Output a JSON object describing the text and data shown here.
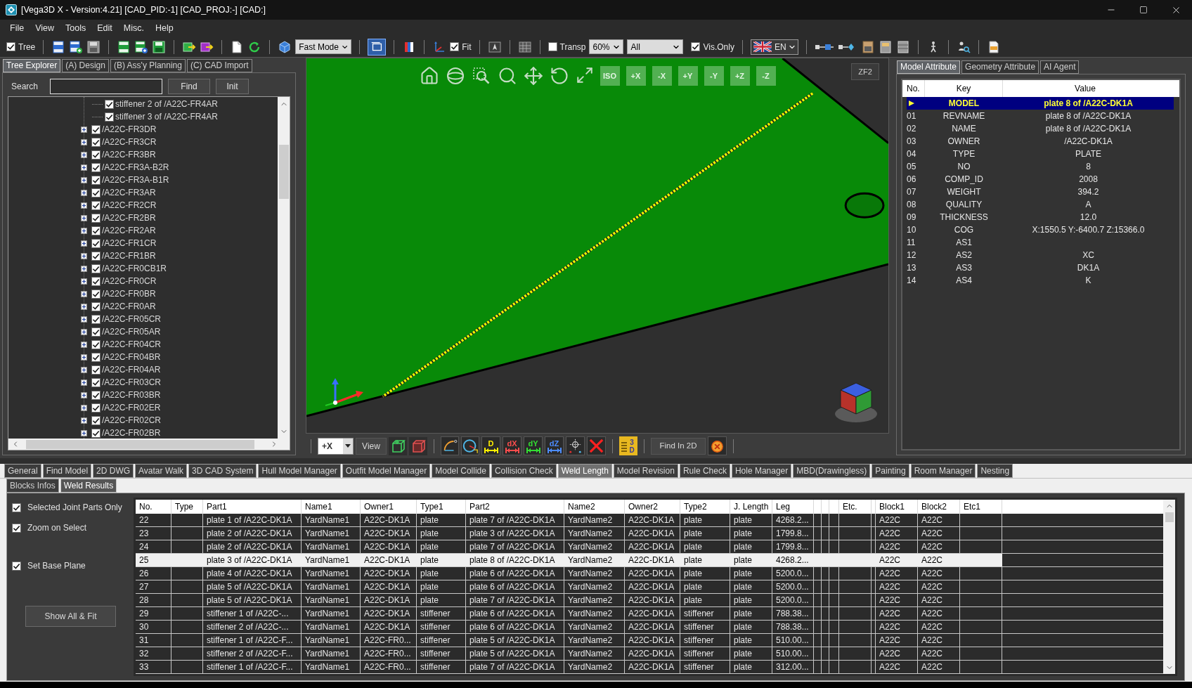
{
  "window": {
    "title": "[Vega3D X - Version:4.21] [CAD_PID:-1] [CAD_PROJ:-] [CAD:]"
  },
  "menu": [
    "File",
    "View",
    "Tools",
    "Edit",
    "Misc.",
    "Help"
  ],
  "toolbar": {
    "tree": {
      "label": "Tree",
      "checked": true
    },
    "render_mode": "Fast Mode",
    "fit": {
      "label": "Fit",
      "checked": true
    },
    "transparency": {
      "label": "Transp",
      "checked": false
    },
    "opacity": "60%",
    "filter": "All",
    "visible_only": {
      "label": "Vis.Only",
      "checked": true
    },
    "language": "EN"
  },
  "left_panel": {
    "tabs": [
      {
        "label": "Tree Explorer",
        "selected": true
      },
      {
        "label": "(A) Design",
        "selected": false
      },
      {
        "label": "(B) Ass'y Planning",
        "selected": false
      },
      {
        "label": "(C) CAD Import",
        "selected": false
      }
    ],
    "search_label": "Search",
    "buttons": [
      "Find",
      "Init"
    ],
    "tree": [
      {
        "children": [
          {
            "label": "stiffener 2 of /A22C-FR4AR",
            "checked": true
          },
          {
            "label": "stiffener 3 of /A22C-FR4AR",
            "checked": true
          }
        ]
      },
      {
        "label": "/A22C-FR3DR",
        "checked": true,
        "expanded": false
      },
      {
        "label": "/A22C-FR3CR",
        "checked": true,
        "expanded": false
      },
      {
        "label": "/A22C-FR3BR",
        "checked": true,
        "expanded": false
      },
      {
        "label": "/A22C-FR3A-B2R",
        "checked": true,
        "expanded": false
      },
      {
        "label": "/A22C-FR3A-B1R",
        "checked": true,
        "expanded": false
      },
      {
        "label": "/A22C-FR3AR",
        "checked": true,
        "expanded": false
      },
      {
        "label": "/A22C-FR2CR",
        "checked": true,
        "expanded": false
      },
      {
        "label": "/A22C-FR2BR",
        "checked": true,
        "expanded": false
      },
      {
        "label": "/A22C-FR2AR",
        "checked": true,
        "expanded": false
      },
      {
        "label": "/A22C-FR1CR",
        "checked": true,
        "expanded": false
      },
      {
        "label": "/A22C-FR1BR",
        "checked": true,
        "expanded": false
      },
      {
        "label": "/A22C-FR0CB1R",
        "checked": true,
        "expanded": false
      },
      {
        "label": "/A22C-FR0CR",
        "checked": true,
        "expanded": false
      },
      {
        "label": "/A22C-FR0BR",
        "checked": true,
        "expanded": false
      },
      {
        "label": "/A22C-FR0AR",
        "checked": true,
        "expanded": false
      },
      {
        "label": "/A22C-FR05CR",
        "checked": true,
        "expanded": false
      },
      {
        "label": "/A22C-FR05AR",
        "checked": true,
        "expanded": false
      },
      {
        "label": "/A22C-FR04CR",
        "checked": true,
        "expanded": false
      },
      {
        "label": "/A22C-FR04BR",
        "checked": true,
        "expanded": false
      },
      {
        "label": "/A22C-FR04AR",
        "checked": true,
        "expanded": false
      },
      {
        "label": "/A22C-FR03CR",
        "checked": true,
        "expanded": false
      },
      {
        "label": "/A22C-FR03BR",
        "checked": true,
        "expanded": false
      },
      {
        "label": "/A22C-FR02ER",
        "checked": true,
        "expanded": false
      },
      {
        "label": "/A22C-FR02CR",
        "checked": true,
        "expanded": false
      },
      {
        "label": "/A22C-FR02BR",
        "checked": true,
        "expanded": false
      }
    ]
  },
  "viewport": {
    "view_buttons": [
      "ISO",
      "+X",
      "-X",
      "+Y",
      "-Y",
      "+Z",
      "-Z"
    ],
    "zoom_badge": "ZF2",
    "view_direction": "+X",
    "view_button": "View",
    "dimension_tools": [
      {
        "label": "D",
        "color": "#ffee00"
      },
      {
        "label": "dX",
        "color": "#ff4d4d"
      },
      {
        "label": "dY",
        "color": "#33dd33"
      },
      {
        "label": "dZ",
        "color": "#4d8cff"
      }
    ],
    "report_button": "3D",
    "find_button": "Find In 2D"
  },
  "attributes": {
    "tabs": [
      {
        "label": "Model Attribute",
        "selected": true
      },
      {
        "label": "Geometry Attribute",
        "selected": false
      },
      {
        "label": "AI Agent",
        "selected": false
      }
    ],
    "columns": [
      "No.",
      "Key",
      "Value"
    ],
    "rows": [
      {
        "key": "MODEL",
        "value": "plate 8 of /A22C-DK1A",
        "selected": true
      },
      {
        "no": "01",
        "key": "REVNAME",
        "value": "plate 8 of /A22C-DK1A",
        "selected": false
      },
      {
        "no": "02",
        "key": "NAME",
        "value": "plate 8 of /A22C-DK1A",
        "selected": false
      },
      {
        "no": "03",
        "key": "OWNER",
        "value": "/A22C-DK1A",
        "selected": false
      },
      {
        "no": "04",
        "key": "TYPE",
        "value": "PLATE",
        "selected": false
      },
      {
        "no": "05",
        "key": "NO",
        "value": "8",
        "selected": false
      },
      {
        "no": "06",
        "key": "COMP_ID",
        "value": "2008",
        "selected": false
      },
      {
        "no": "07",
        "key": "WEIGHT",
        "value": "394.2",
        "selected": false
      },
      {
        "no": "08",
        "key": "QUALITY",
        "value": "A",
        "selected": false
      },
      {
        "no": "09",
        "key": "THICKNESS",
        "value": "12.0",
        "selected": false
      },
      {
        "no": "10",
        "key": "COG",
        "value": "X:1550.5 Y:-6400.7 Z:15366.0",
        "selected": false
      },
      {
        "no": "11",
        "key": "AS1",
        "selected": false
      },
      {
        "no": "12",
        "key": "AS2",
        "value": "XC",
        "selected": false
      },
      {
        "no": "13",
        "key": "AS3",
        "value": "DK1A",
        "selected": false
      },
      {
        "no": "14",
        "key": "AS4",
        "value": "K",
        "selected": false
      }
    ]
  },
  "bottom": {
    "tabs": [
      {
        "label": "General",
        "selected": false
      },
      {
        "label": "Find Model",
        "selected": false
      },
      {
        "label": "2D DWG",
        "selected": false
      },
      {
        "label": "Avatar Walk",
        "selected": false
      },
      {
        "label": "3D CAD System",
        "selected": false
      },
      {
        "label": "Hull Model Manager",
        "selected": false
      },
      {
        "label": "Outfit Model Manager",
        "selected": false
      },
      {
        "label": "Model Collide",
        "selected": false
      },
      {
        "label": "Collision Check",
        "selected": false
      },
      {
        "label": "Weld Length",
        "selected": true
      },
      {
        "label": "Model Revision",
        "selected": false
      },
      {
        "label": "Rule Check",
        "selected": false
      },
      {
        "label": "Hole Manager",
        "selected": false
      },
      {
        "label": "MBD(Drawingless)",
        "selected": false
      },
      {
        "label": "Painting",
        "selected": false
      },
      {
        "label": "Room Manager",
        "selected": false
      },
      {
        "label": "Nesting",
        "selected": false
      }
    ],
    "subtabs": [
      {
        "label": "Blocks Infos",
        "selected": false
      },
      {
        "label": "Weld Results",
        "selected": true
      }
    ],
    "options": [
      {
        "label": "Selected Joint Parts Only",
        "checked": true
      },
      {
        "label": "Zoom on Select",
        "checked": true
      },
      {
        "label": "Set Base Plane",
        "checked": true
      }
    ],
    "show_all_button": "Show All & Fit",
    "table": {
      "columns": [
        "No.",
        "Type",
        "Part1",
        "Name1",
        "Owner1",
        "Type1",
        "Part2",
        "Name2",
        "Owner2",
        "Type2",
        "J. Length",
        "Leg",
        "Etc.",
        "Block1",
        "Block2",
        "Etc1"
      ],
      "rows": [
        {
          "no": "22",
          "part1": "plate 1 of /A22C-DK1A",
          "name1": "YardName1",
          "owner1": "A22C-DK1A",
          "type1": "plate",
          "part2": "plate 7 of /A22C-DK1A",
          "name2": "YardName2",
          "owner2": "A22C-DK1A",
          "type2": "plate",
          "j_length": "plate",
          "leg": "4268.2...",
          "block1": "A22C",
          "block2": "A22C",
          "selected": false
        },
        {
          "no": "23",
          "part1": "plate 2 of /A22C-DK1A",
          "name1": "YardName1",
          "owner1": "A22C-DK1A",
          "type1": "plate",
          "part2": "plate 3 of /A22C-DK1A",
          "name2": "YardName2",
          "owner2": "A22C-DK1A",
          "type2": "plate",
          "j_length": "plate",
          "leg": "1799.8...",
          "block1": "A22C",
          "block2": "A22C",
          "selected": false
        },
        {
          "no": "24",
          "part1": "plate 2 of /A22C-DK1A",
          "name1": "YardName1",
          "owner1": "A22C-DK1A",
          "type1": "plate",
          "part2": "plate 7 of /A22C-DK1A",
          "name2": "YardName2",
          "owner2": "A22C-DK1A",
          "type2": "plate",
          "j_length": "plate",
          "leg": "1799.8...",
          "block1": "A22C",
          "block2": "A22C",
          "selected": false
        },
        {
          "no": "25",
          "part1": "plate 3 of /A22C-DK1A",
          "name1": "YardName1",
          "owner1": "A22C-DK1A",
          "type1": "plate",
          "part2": "plate 8 of /A22C-DK1A",
          "name2": "YardName2",
          "owner2": "A22C-DK1A",
          "type2": "plate",
          "j_length": "plate",
          "leg": "4268.2...",
          "block1": "A22C",
          "block2": "A22C",
          "selected": true
        },
        {
          "no": "26",
          "part1": "plate 4 of /A22C-DK1A",
          "name1": "YardName1",
          "owner1": "A22C-DK1A",
          "type1": "plate",
          "part2": "plate 6 of /A22C-DK1A",
          "name2": "YardName2",
          "owner2": "A22C-DK1A",
          "type2": "plate",
          "j_length": "plate",
          "leg": "5200.0...",
          "block1": "A22C",
          "block2": "A22C",
          "selected": false
        },
        {
          "no": "27",
          "part1": "plate 5 of /A22C-DK1A",
          "name1": "YardName1",
          "owner1": "A22C-DK1A",
          "type1": "plate",
          "part2": "plate 6 of /A22C-DK1A",
          "name2": "YardName2",
          "owner2": "A22C-DK1A",
          "type2": "plate",
          "j_length": "plate",
          "leg": "5200.0...",
          "block1": "A22C",
          "block2": "A22C",
          "selected": false
        },
        {
          "no": "28",
          "part1": "plate 5 of /A22C-DK1A",
          "name1": "YardName1",
          "owner1": "A22C-DK1A",
          "type1": "plate",
          "part2": "plate 7 of /A22C-DK1A",
          "name2": "YardName2",
          "owner2": "A22C-DK1A",
          "type2": "plate",
          "j_length": "plate",
          "leg": "5200.0...",
          "block1": "A22C",
          "block2": "A22C",
          "selected": false
        },
        {
          "no": "29",
          "part1": "stiffener 1 of /A22C-...",
          "name1": "YardName1",
          "owner1": "A22C-DK1A",
          "type1": "stiffener",
          "part2": "plate 6 of /A22C-DK1A",
          "name2": "YardName2",
          "owner2": "A22C-DK1A",
          "type2": "stiffener",
          "j_length": "plate",
          "leg": "788.38...",
          "block1": "A22C",
          "block2": "A22C",
          "selected": false
        },
        {
          "no": "30",
          "part1": "stiffener 2 of /A22C-...",
          "name1": "YardName1",
          "owner1": "A22C-DK1A",
          "type1": "stiffener",
          "part2": "plate 6 of /A22C-DK1A",
          "name2": "YardName2",
          "owner2": "A22C-DK1A",
          "type2": "stiffener",
          "j_length": "plate",
          "leg": "788.38...",
          "block1": "A22C",
          "block2": "A22C",
          "selected": false
        },
        {
          "no": "31",
          "part1": "stiffener 1 of /A22C-F...",
          "name1": "YardName1",
          "owner1": "A22C-FR0...",
          "type1": "stiffener",
          "part2": "plate 5 of /A22C-DK1A",
          "name2": "YardName2",
          "owner2": "A22C-DK1A",
          "type2": "stiffener",
          "j_length": "plate",
          "leg": "510.00...",
          "block1": "A22C",
          "block2": "A22C",
          "selected": false
        },
        {
          "no": "32",
          "part1": "stiffener 2 of /A22C-F...",
          "name1": "YardName1",
          "owner1": "A22C-FR0...",
          "type1": "stiffener",
          "part2": "plate 5 of /A22C-DK1A",
          "name2": "YardName2",
          "owner2": "A22C-DK1A",
          "type2": "stiffener",
          "j_length": "plate",
          "leg": "510.00...",
          "block1": "A22C",
          "block2": "A22C",
          "selected": false
        },
        {
          "no": "33",
          "part1": "stiffener 1 of /A22C-F...",
          "name1": "YardName1",
          "owner1": "A22C-FR0...",
          "type1": "stiffener",
          "part2": "plate 7 of /A22C-DK1A",
          "name2": "YardName2",
          "owner2": "A22C-DK1A",
          "type2": "stiffener",
          "j_length": "plate",
          "leg": "312.00...",
          "block1": "A22C",
          "block2": "A22C",
          "selected": false
        }
      ]
    }
  }
}
